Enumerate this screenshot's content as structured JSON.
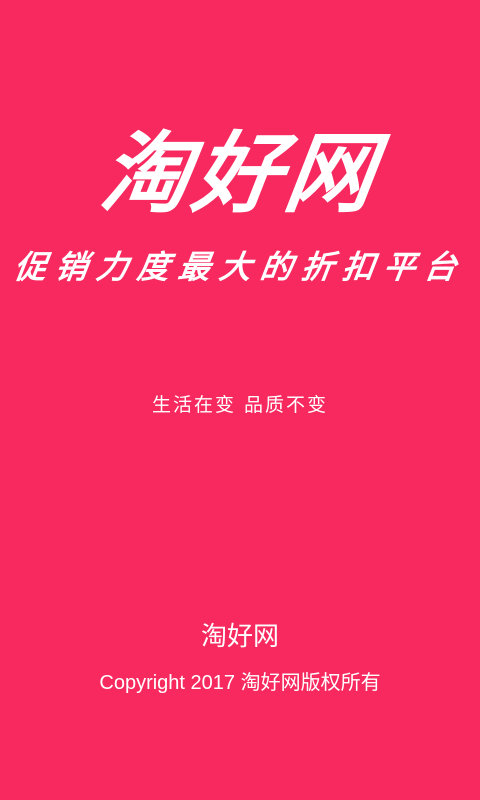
{
  "splash": {
    "background_color": "#f7295f",
    "text_color": "#ffffff",
    "brand_title": "淘好网",
    "slogan": "促销力度最大的折扣平台",
    "tagline": "生活在变 品质不变",
    "footer_brand": "淘好网",
    "copyright": "Copyright 2017 淘好网版权所有"
  }
}
